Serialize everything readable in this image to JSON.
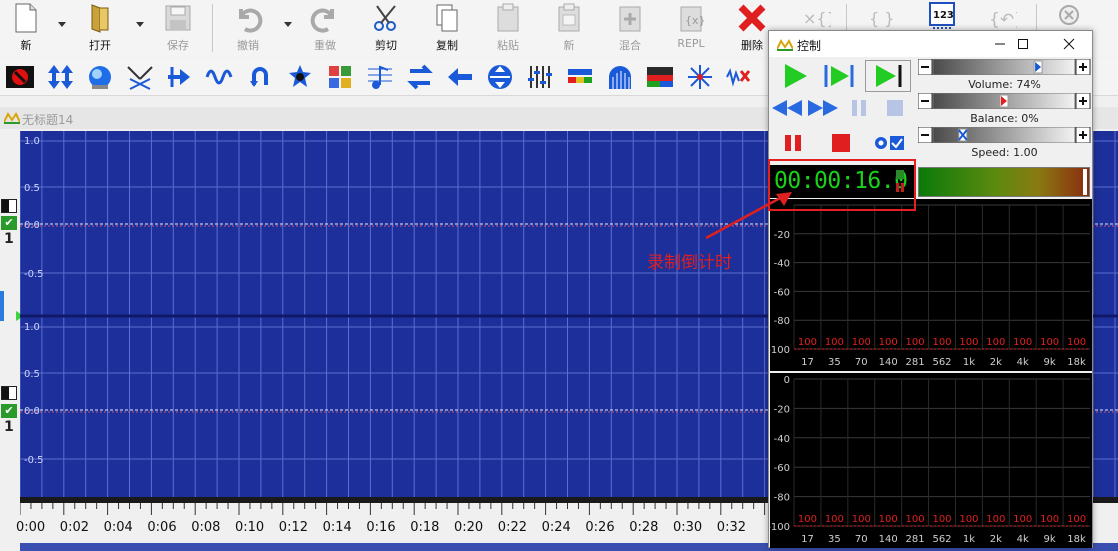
{
  "toolbar_main": {
    "new": "新",
    "open": "打开",
    "save": "保存",
    "undo": "撤销",
    "redo": "重做",
    "cut": "剪切",
    "copy": "复制",
    "paste": "粘贴",
    "new2": "新",
    "mix": "混合",
    "repl": "REPL",
    "delete": "删除"
  },
  "document": {
    "title": "无标题14"
  },
  "tracks": [
    {
      "number": "1",
      "ticks": [
        "1.0",
        "0.5",
        "0.0",
        "-0.5"
      ]
    },
    {
      "number": "1",
      "ticks": [
        "1.0",
        "0.5",
        "0.0",
        "-0.5"
      ]
    }
  ],
  "timeline": {
    "labels": [
      "0:00",
      "0:02",
      "0:04",
      "0:06",
      "0:08",
      "0:10",
      "0:12",
      "0:14",
      "0:16",
      "0:18",
      "0:20",
      "0:22",
      "0:24",
      "0:26",
      "0:28",
      "0:30",
      "0:32"
    ]
  },
  "control": {
    "title": "控制",
    "volume_label": "Volume: 74%",
    "volume": 0.74,
    "balance_label": "Balance: 0%",
    "balance": 0.0,
    "speed_label": "Speed: 1.00",
    "speed": 1.0,
    "time": "00:00:16.0",
    "spectrum": {
      "db_ticks": [
        "0",
        "-20",
        "-40",
        "-60",
        "-80",
        "-100"
      ],
      "freq_labels": [
        "17",
        "35",
        "70",
        "140",
        "281",
        "562",
        "1k",
        "2k",
        "4k",
        "9k",
        "18k"
      ],
      "band_values": [
        "100",
        "100",
        "100",
        "100",
        "100",
        "100",
        "100",
        "100",
        "100",
        "100",
        "100"
      ]
    }
  },
  "annotation": {
    "text": "录制倒计时",
    "color": "#e01f1f"
  },
  "colors": {
    "wave_bg": "#1d2f9a",
    "grid": "#5a6fcf",
    "time_green": "#18d318",
    "accent_red": "#e62020"
  }
}
